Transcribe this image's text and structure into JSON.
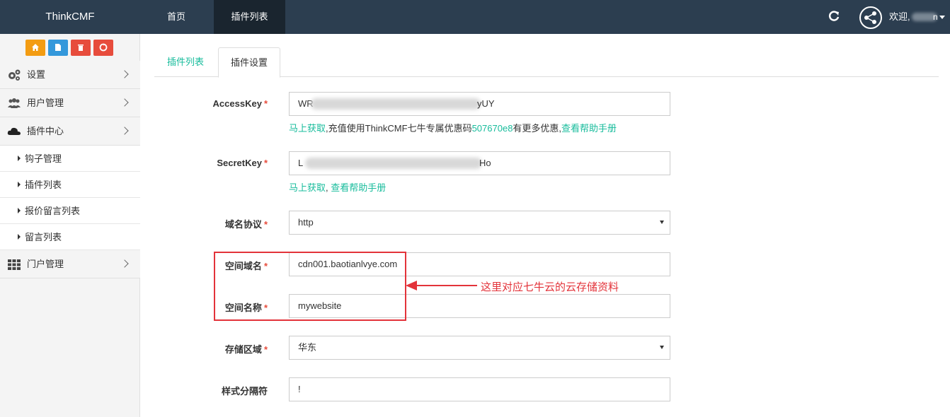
{
  "nav": {
    "brand": "ThinkCMF",
    "home": "首页",
    "plugins": "插件列表",
    "welcome": "欢迎, ",
    "username_tail": "n"
  },
  "sidebar": {
    "menu": [
      {
        "label": "设置",
        "icon": "gears-icon"
      },
      {
        "label": "用户管理",
        "icon": "users-icon"
      },
      {
        "label": "插件中心",
        "icon": "cloud-icon"
      }
    ],
    "sub_items": [
      "钩子管理",
      "插件列表",
      "报价留言列表",
      "留言列表"
    ],
    "portal": {
      "label": "门户管理",
      "icon": "grid-icon"
    }
  },
  "tabs": {
    "list": "插件列表",
    "settings": "插件设置"
  },
  "form": {
    "access_key": {
      "label": "AccessKey",
      "value_start": "WR",
      "value_end": "yUY",
      "help_link1": "马上获取",
      "help_text1": ",充值使用ThinkCMF七牛专属优惠码",
      "help_code": "507670e8",
      "help_text2": "有更多优惠,",
      "help_link2": "查看帮助手册"
    },
    "secret_key": {
      "label": "SecretKey",
      "value_start": "L",
      "value_end": "Ho",
      "help_link1": "马上获取",
      "help_sep": ", ",
      "help_link2": "查看帮助手册"
    },
    "protocol": {
      "label": "域名协议",
      "value": "http"
    },
    "domain": {
      "label": "空间域名",
      "value": "cdn001.baotianlvye.com"
    },
    "bucket": {
      "label": "空间名称",
      "value": "mywebsite"
    },
    "zone": {
      "label": "存储区域",
      "value": "华东"
    },
    "style_separator": {
      "label": "样式分隔符",
      "value": "!"
    },
    "required_mark": "*"
  },
  "annotation": "这里对应七牛云的云存储资料",
  "colors": {
    "topbar": "#2c3e50",
    "accent": "#18bc9c",
    "required": "#e74c3c",
    "annotation": "#e3333a"
  }
}
